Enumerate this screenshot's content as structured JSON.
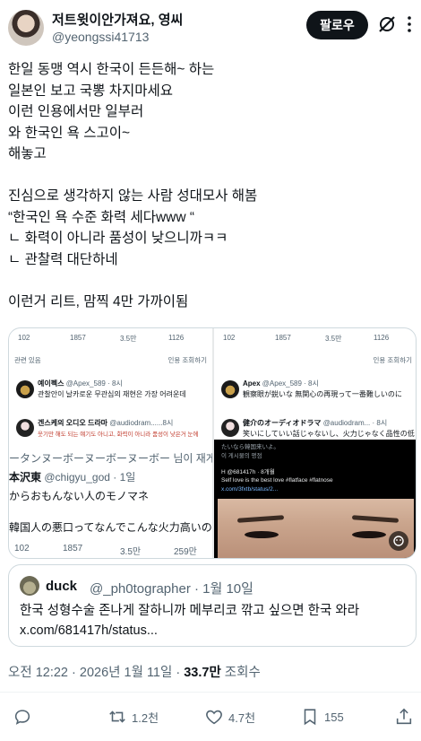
{
  "author": {
    "display_name": "저트윗이안가져요, 영씨",
    "handle": "@yeongssi41713",
    "follow_label": "팔로우"
  },
  "icons": {
    "grok": "grok-icon",
    "more": "more-vertical-icon",
    "reply": "reply-icon",
    "retweet": "retweet-icon",
    "like": "heart-icon",
    "bookmark": "bookmark-icon",
    "share": "share-icon"
  },
  "tweet": {
    "lines": [
      "한일 동맹 역시 한국이 든든해~ 하는",
      "일본인 보고 국뽕 차지마세요",
      "이런 인용에서만 일부러",
      "와 한국인 욕 스고이~",
      "해놓고",
      "",
      "진심으로 생각하지 않는 사람 성대모사 해봄",
      "“한국인 욕 수준 화력 세다www “",
      " ㄴ 화력이 아니라 품성이 낮으니까ㅋㅋ",
      " ㄴ 관찰력 대단하네",
      "",
      "이런거 리트, 맘찍 4만 가까이됨"
    ]
  },
  "media": {
    "left": {
      "stats": [
        "102",
        "1857",
        "3.5만",
        "1126"
      ],
      "sort_label": "관련 있음",
      "quote_views_label": "인용 조회하기",
      "reply1_name": "예이펙스",
      "reply1_handle": "@Apex_589 · 8시",
      "reply1_text": "관찰안이 날카로운 무관심의 재현은 가장 어려운데",
      "reply2_name": "겐스케의 오디오 드라마",
      "reply2_handle": "@audiodram......8시",
      "reply2_text": "웃기만 해도 되는 얘기도 아니고, 화력이 아니라 품성이 낮은거 눈에",
      "big1": "ータンヌーボーヌーボーヌーボー 님이 재게시함",
      "big2_name": "本沢東",
      "big2_handle": "@chigyu_god · 1일",
      "big3": "からおもんない人のモノマネ",
      "big4": "韓国人の悪口ってなんでこんな火力高いの",
      "bottom_stats": [
        "102",
        "1857",
        "3.5만",
        "259만"
      ]
    },
    "right": {
      "stats": [
        "102",
        "1857",
        "3.5만",
        "1126"
      ],
      "quote_views_label": "인용 조회하기",
      "reply1_name": "Apex",
      "reply1_handle": "@Apex_589 · 8시",
      "reply1_text": "観察眼が鋭いな 無関心の再現って一番難しいのに",
      "reply2_name": "健介のオーディオドラマ",
      "reply2_handle": "@audiodram... · 8시",
      "reply2_text": "笑いにしていい話じゃないし、火力じゃなく品性の低",
      "reply2_more": "たいなら韓国来いよ。",
      "card_label": "이 게시물의 평점",
      "card_user": "H @681417h · 8개월",
      "card_text": "Self love is the best love #flatface #flatnose",
      "card_link": "x.com/3fxtb/status/2..."
    }
  },
  "quote": {
    "name": "duck",
    "meta": "@_ph0tographer · 1월 10일",
    "lines": [
      "한국 성형수술 존나게 잘하니까 메부리코 깎고 싶으면 한국 와라",
      "x.com/681417h/status..."
    ]
  },
  "timestamp": {
    "time": "오전 12:22 · 2026년 1월 11일 · ",
    "views": "33.7만",
    "views_label": " 조회수"
  },
  "actions": {
    "retweets": "1.2천",
    "likes": "4.7천",
    "bookmarks": "155"
  }
}
